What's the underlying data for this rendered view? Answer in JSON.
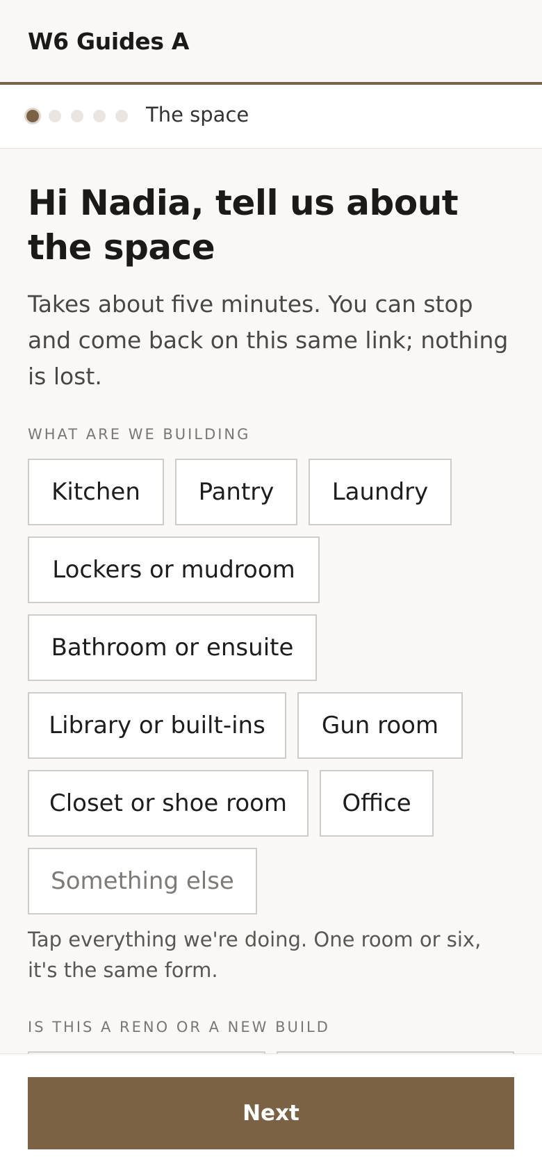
{
  "header": {
    "brand": "W6 Guides A"
  },
  "progress": {
    "step_label": "The space",
    "steps_total": 5,
    "current_step": 1
  },
  "intro": {
    "headline": "Hi Nadia, tell us about the space",
    "body": "Takes about five minutes. You can stop and come back on this same link; nothing is lost."
  },
  "building": {
    "label": "WHAT ARE WE BUILDING",
    "options": [
      "Kitchen",
      "Pantry",
      "Laundry",
      "Lockers or mudroom",
      "Bathroom or ensuite",
      "Library or built-ins",
      "Gun room",
      "Closet or shoe room",
      "Office",
      "Something else"
    ],
    "help": "Tap everything we're doing. One room or six, it's the same form."
  },
  "reno": {
    "label": "IS THIS A RENO OR A NEW BUILD"
  },
  "footer": {
    "next_label": "Next"
  },
  "colors": {
    "accent": "#7b6245",
    "background": "#f9f8f6",
    "chip_border": "#cfcbc6"
  }
}
